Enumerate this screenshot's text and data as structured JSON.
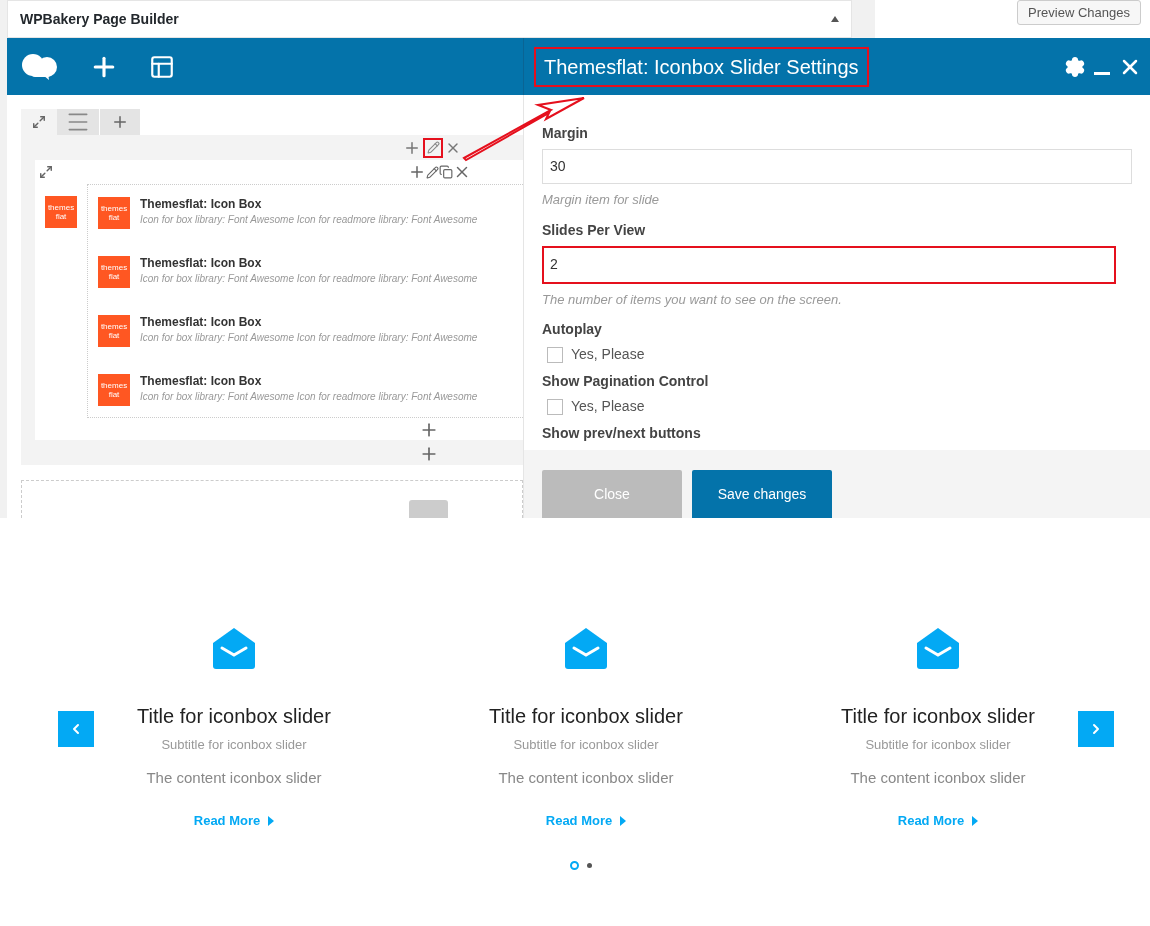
{
  "builder": {
    "title": "WPBakery Page Builder",
    "preview_button": "Preview Changes",
    "row_edit_highlighted": true,
    "column_logo_text": "themes flat",
    "elements": [
      {
        "logo_text": "themes flat",
        "title": "Themesflat: Icon Box",
        "description": "Icon for box library: Font Awesome  Icon for readmore library: Font Awesome"
      },
      {
        "logo_text": "themes flat",
        "title": "Themesflat: Icon Box",
        "description": "Icon for box library: Font Awesome  Icon for readmore library: Font Awesome"
      },
      {
        "logo_text": "themes flat",
        "title": "Themesflat: Icon Box",
        "description": "Icon for box library: Font Awesome  Icon for readmore library: Font Awesome"
      },
      {
        "logo_text": "themes flat",
        "title": "Themesflat: Icon Box",
        "description": "Icon for box library: Font Awesome  Icon for readmore library: Font Awesome"
      }
    ]
  },
  "settings": {
    "title": "Themesflat: Iconbox Slider Settings",
    "title_highlighted": true,
    "fields": [
      {
        "kind": "text",
        "label": "Margin",
        "value": "30",
        "help": "Margin item for slide",
        "highlighted": false
      },
      {
        "kind": "text",
        "label": "Slides Per View",
        "value": "2",
        "help": "The number of items you want to see on the screen.",
        "highlighted": true
      },
      {
        "kind": "checkbox",
        "label": "Autoplay",
        "option": "Yes, Please",
        "checked": false
      },
      {
        "kind": "checkbox",
        "label": "Show Pagination Control",
        "option": "Yes, Please",
        "checked": false
      },
      {
        "kind": "heading",
        "label": "Show prev/next buttons"
      }
    ],
    "buttons": [
      {
        "kind": "secondary",
        "label": "Close"
      },
      {
        "kind": "primary",
        "label": "Save changes"
      }
    ]
  },
  "slider": {
    "slides": [
      {
        "title": "Title for iconbox slider",
        "subtitle": "Subtitle for iconbox slider",
        "content": "The content iconbox slider",
        "link": "Read More"
      },
      {
        "title": "Title for iconbox slider",
        "subtitle": "Subtitle for iconbox slider",
        "content": "The content iconbox slider",
        "link": "Read More"
      },
      {
        "title": "Title for iconbox slider",
        "subtitle": "Subtitle for iconbox slider",
        "content": "The content iconbox slider",
        "link": "Read More"
      }
    ],
    "dots": [
      {
        "selected": true
      },
      {
        "selected": false
      }
    ]
  }
}
